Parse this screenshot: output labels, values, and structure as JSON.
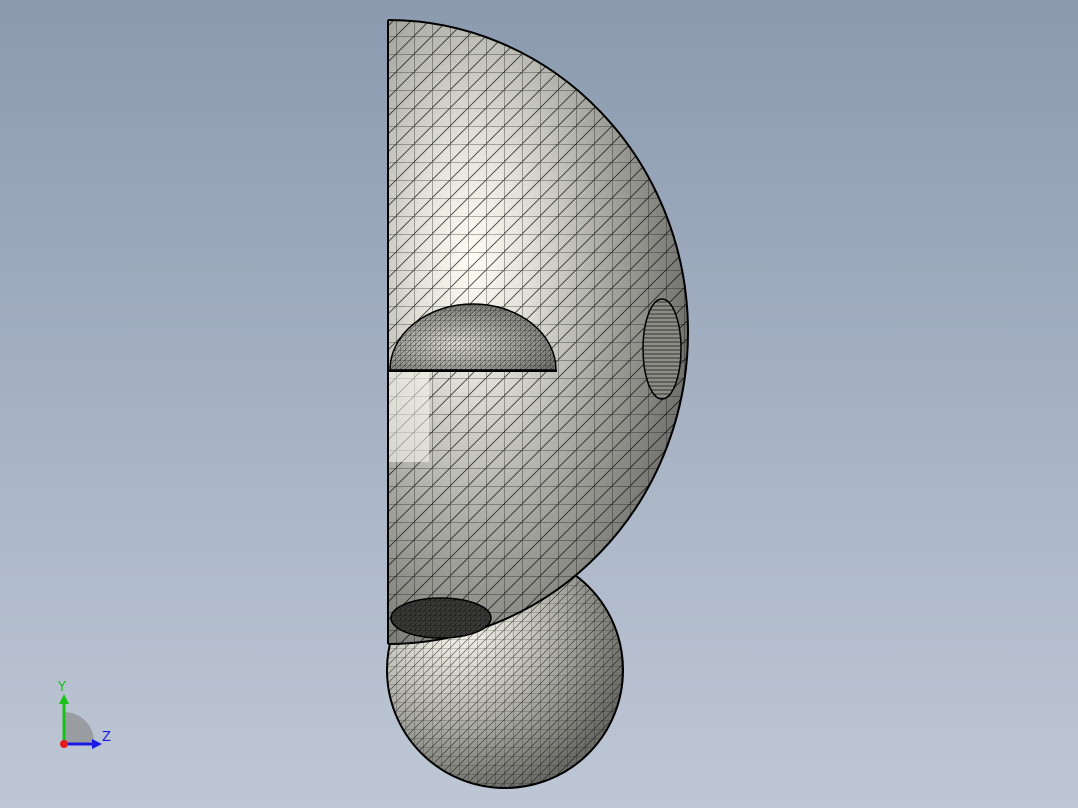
{
  "viewport": {
    "background_top": "#8b9aaf",
    "background_bottom": "#bec7d5"
  },
  "model": {
    "shading": "shaded-with-mesh-edges",
    "mesh_color": "#000000",
    "surface_color": "#b9b9b2",
    "highlight_color": "#fbfbf2",
    "parts": [
      "large-hemisphere-shell",
      "inner-half-dome",
      "side-circular-opening",
      "lower-sphere",
      "bottom-cup-opening"
    ]
  },
  "triad": {
    "y_label": "Y",
    "z_label": "Z",
    "y_color": "#19c119",
    "z_color": "#1a1ae6",
    "x_color": "#e61a1a"
  }
}
